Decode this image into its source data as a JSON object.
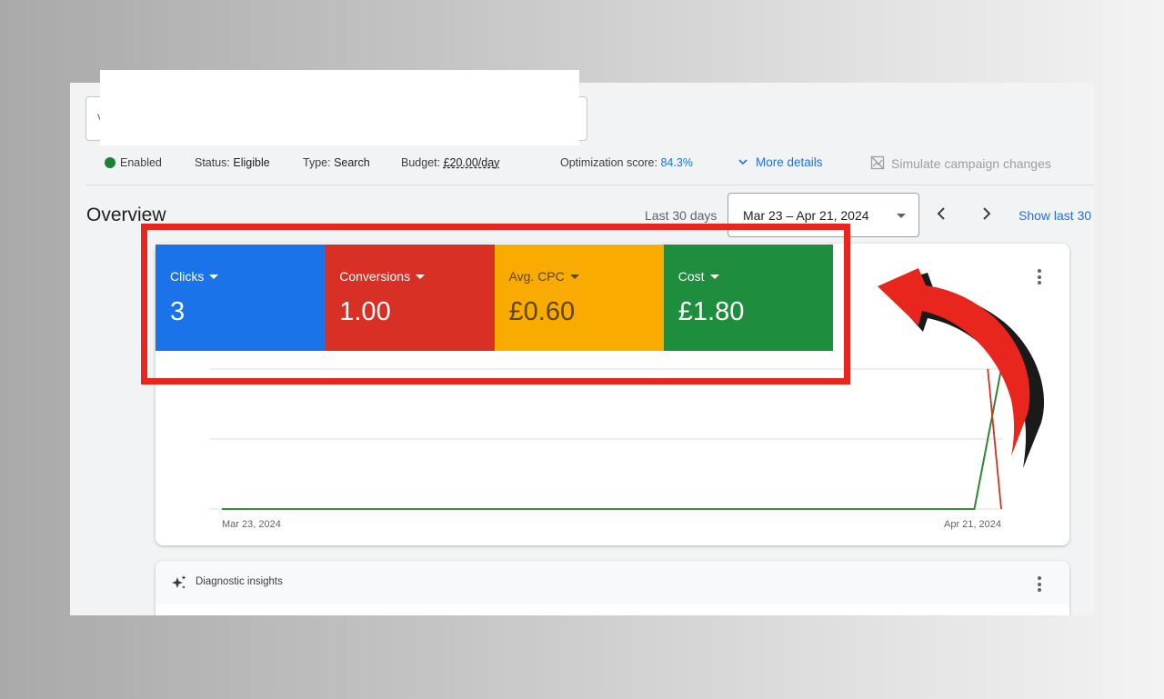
{
  "campaign": {
    "search_initial": "V",
    "status_state": "Enabled",
    "status_label": "Status:",
    "status_value": "Eligible",
    "type_label": "Type:",
    "type_value": "Search",
    "budget_label": "Budget:",
    "budget_value": "£20.00/day",
    "opt_label": "Optimization score:",
    "opt_value": "84.3%",
    "more_details": "More details",
    "simulate": "Simulate campaign changes"
  },
  "overview": {
    "title": "Overview",
    "range_label": "Last 30 days",
    "date_range": "Mar 23 – Apr 21, 2024",
    "show_last": "Show last 30"
  },
  "metrics": [
    {
      "label": "Clicks",
      "value": "3",
      "color": "#1a73e8"
    },
    {
      "label": "Conversions",
      "value": "1.00",
      "color": "#d93025"
    },
    {
      "label": "Avg. CPC",
      "value": "£0.60",
      "color": "#f9ab00"
    },
    {
      "label": "Cost",
      "value": "£1.80",
      "color": "#1e8e3e"
    }
  ],
  "chart_data": {
    "type": "line",
    "x": [
      "Mar 23, 2024",
      "Apr 20, 2024",
      "Apr 21, 2024"
    ],
    "x_tick_labels": [
      "Mar 23, 2024",
      "Apr 21, 2024"
    ],
    "series": [
      {
        "name": "Clicks",
        "color": "#1a73e8",
        "values": [
          0,
          0,
          3
        ]
      },
      {
        "name": "Conversions",
        "color": "#d93025",
        "values": [
          0,
          0,
          1.0
        ]
      },
      {
        "name": "Avg. CPC",
        "color": "#f9ab00",
        "values": [
          0,
          0,
          0.6
        ]
      },
      {
        "name": "Cost",
        "color": "#1e8e3e",
        "values": [
          0,
          0,
          1.8
        ]
      }
    ],
    "grid": true
  },
  "diagnostics": {
    "title": "Diagnostic insights"
  },
  "annotation": {
    "box_color": "#e8261d",
    "arrow_color": "#e8261d"
  }
}
